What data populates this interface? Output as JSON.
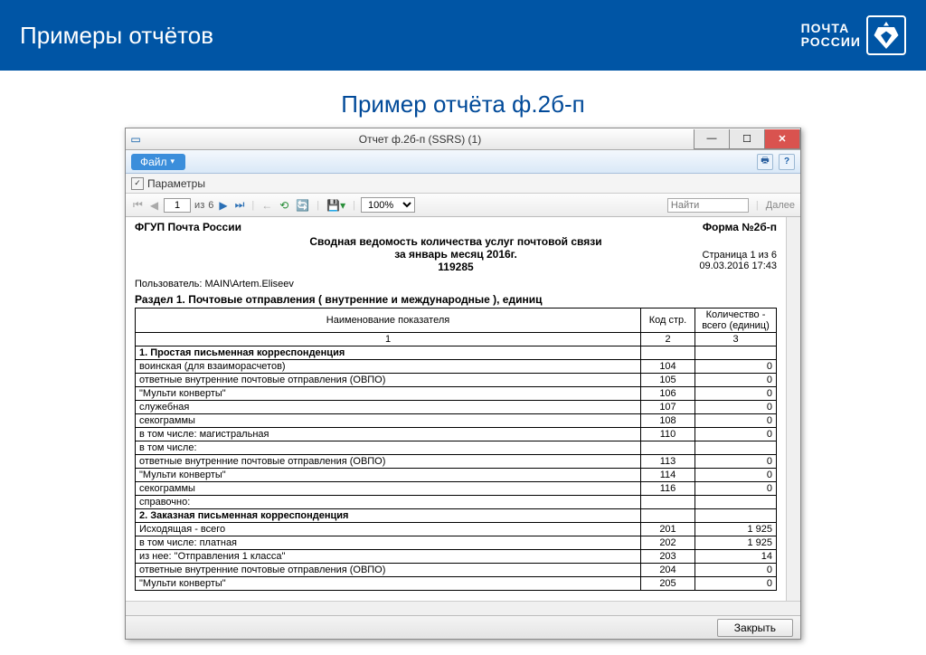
{
  "slide": {
    "title": "Примеры отчётов",
    "subtitle": "Пример отчёта ф.2б-п",
    "logo_line1": "ПОЧТА",
    "logo_line2": "РОССИИ"
  },
  "window": {
    "title": "Отчет ф.2б-п (SSRS) (1)",
    "menu_file": "Файл",
    "params_label": "Параметры",
    "close_button": "Закрыть"
  },
  "toolbar": {
    "page_current": "1",
    "page_of_label": "из",
    "page_total": "6",
    "zoom": "100%",
    "find_placeholder": "Найти",
    "next_label": "Далее"
  },
  "report": {
    "org": "ФГУП Почта России",
    "form_no": "Форма №2б-п",
    "title": "Сводная ведомость количества услуг почтовой связи",
    "period": "за январь месяц  2016г.",
    "code": "119285",
    "page_info": "Страница 1 из 6",
    "datetime": "09.03.2016 17:43",
    "user_label": "Пользователь: MAIN\\Artem.Eliseev",
    "section1": "Раздел 1. Почтовые отправления ( внутренние и международные ), единиц",
    "headers": {
      "name": "Наименование показателя",
      "code": "Код стр.",
      "qty": "Количество - всего (единиц)",
      "num1": "1",
      "num2": "2",
      "num3": "3"
    },
    "rows": [
      {
        "name": "1. Простая письменная корреспонденция",
        "code": "",
        "qty": "",
        "bold": true,
        "indent": 0
      },
      {
        "name": "воинская (для взаиморасчетов)",
        "code": "104",
        "qty": "0",
        "indent": 2
      },
      {
        "name": "ответные внутренние почтовые отправления (ОВПО)",
        "code": "105",
        "qty": "0",
        "indent": 2
      },
      {
        "name": "\"Мульти конверты\"",
        "code": "106",
        "qty": "0",
        "indent": 2
      },
      {
        "name": "служебная",
        "code": "107",
        "qty": "0",
        "indent": 1
      },
      {
        "name": "секограммы",
        "code": "108",
        "qty": "0",
        "indent": 1
      },
      {
        "name": "в том числе: магистральная",
        "code": "110",
        "qty": "0",
        "indent": 1
      },
      {
        "name": "в том числе:",
        "code": "",
        "qty": "",
        "indent": 1
      },
      {
        "name": "ответные внутренние почтовые отправления (ОВПО)",
        "code": "113",
        "qty": "0",
        "indent": 2
      },
      {
        "name": "\"Мульти конверты\"",
        "code": "114",
        "qty": "0",
        "indent": 2
      },
      {
        "name": "секограммы",
        "code": "116",
        "qty": "0",
        "indent": 2
      },
      {
        "name": "справочно:",
        "code": "",
        "qty": "",
        "indent": 1
      },
      {
        "name": "2. Заказная письменная корреспонденция",
        "code": "",
        "qty": "",
        "bold": true,
        "indent": 0
      },
      {
        "name": "Исходящая - всего",
        "code": "201",
        "qty": "1 925",
        "indent": 1
      },
      {
        "name": "в том числе: платная",
        "code": "202",
        "qty": "1 925",
        "indent": 2
      },
      {
        "name": "из нее: \"Отправления 1 класса\"",
        "code": "203",
        "qty": "14",
        "indent": 3
      },
      {
        "name": "ответные внутренние почтовые отправления (ОВПО)",
        "code": "204",
        "qty": "0",
        "indent": 3
      },
      {
        "name": "\"Мульти конверты\"",
        "code": "205",
        "qty": "0",
        "indent": 3
      }
    ]
  }
}
